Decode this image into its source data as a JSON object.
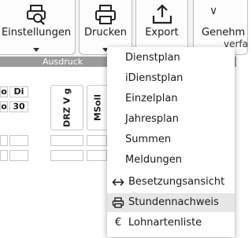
{
  "ribbon": {
    "einstellungen": {
      "label": "Einstellungen",
      "icon": "printer-search-icon"
    },
    "drucken": {
      "label": "Drucken",
      "icon": "printer-icon"
    },
    "export": {
      "label": "Export",
      "icon": "export-upload-icon"
    },
    "genehmigung": {
      "label_line1": "Genehm",
      "label_line2": "verfa",
      "icon": "chevron-icon"
    },
    "group_label": "Ausdruck"
  },
  "grid": {
    "days": [
      "o",
      "Di"
    ],
    "dates": [
      "o",
      "30"
    ],
    "columns": [
      "DRZ V g",
      "MSoll"
    ]
  },
  "print_menu": {
    "items": [
      {
        "label": "Dienstplan"
      },
      {
        "label": "iDienstplan"
      },
      {
        "label": "Einzelplan"
      },
      {
        "label": "Jahresplan"
      },
      {
        "label": "Summen"
      },
      {
        "label": "Meldungen"
      },
      {
        "label": "Besetzungsansicht",
        "icon": "double-arrow-icon"
      },
      {
        "label": "Stundennachweis",
        "icon": "printer-icon",
        "highlighted": true
      },
      {
        "label": "Lohnartenliste",
        "icon": "euro-icon"
      }
    ]
  }
}
